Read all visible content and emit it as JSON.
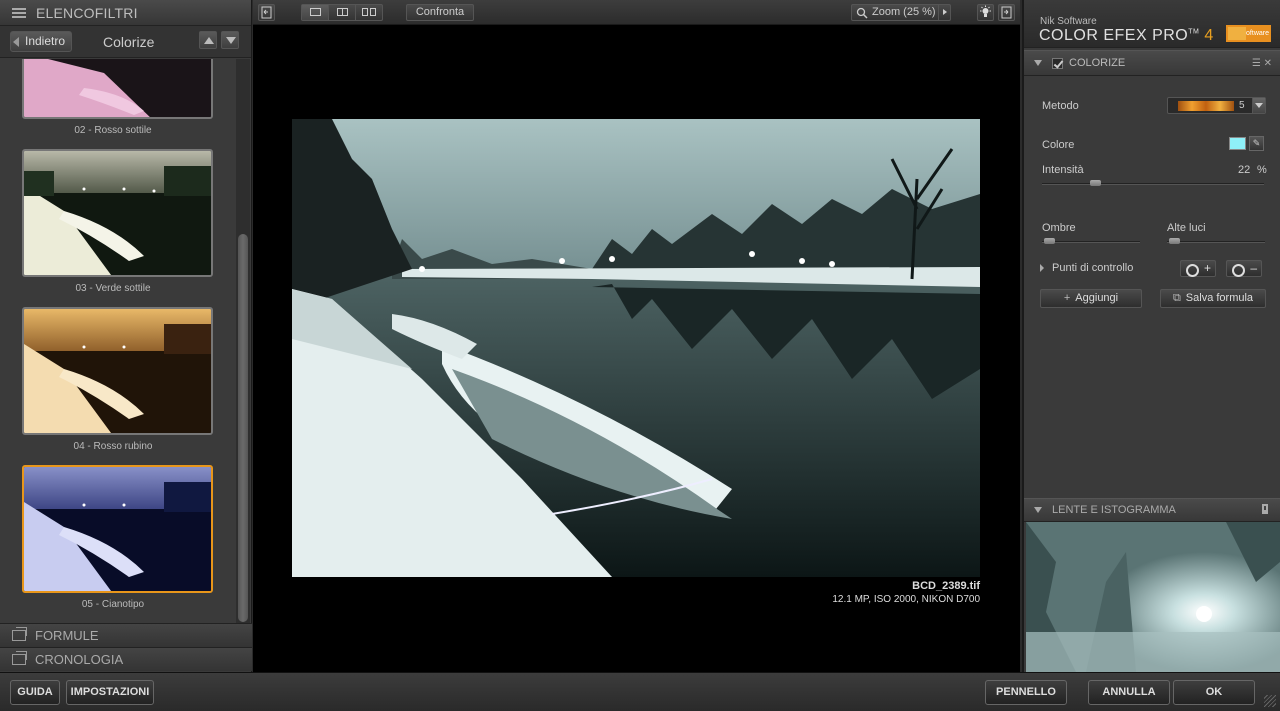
{
  "left_panel": {
    "header": "ELENCOFILTRI",
    "back_label": "Indietro",
    "nav_title": "Colorize",
    "thumbnails": [
      {
        "label": "02 - Rosso sottile",
        "selected": false
      },
      {
        "label": "03 - Verde sottile",
        "selected": false
      },
      {
        "label": "04 - Rosso rubino",
        "selected": false
      },
      {
        "label": "05 - Cianotipo",
        "selected": true
      }
    ],
    "sections": [
      "FORMULE",
      "CRONOLOGIA"
    ]
  },
  "toolbar": {
    "compare_label": "Confronta",
    "zoom_label": "Zoom (25 %)"
  },
  "image_info": {
    "filename": "BCD_2389.tif",
    "meta": "12.1 MP, ISO 2000, NIKON D700"
  },
  "right_panel": {
    "brand_small": "Nik Software",
    "brand_name": "COLOR EFEX PRO",
    "brand_tm": "TM",
    "brand_version": "4",
    "logo_text": "Software",
    "filter_title": "COLORIZE",
    "method_label": "Metodo",
    "method_value": "5",
    "color_label": "Colore",
    "color_value": "#8ff0f8",
    "intensity_label": "Intensità",
    "intensity_value": "22",
    "intensity_unit": "%",
    "shadows_label": "Ombre",
    "highlights_label": "Alte luci",
    "control_points_label": "Punti di controllo",
    "cp_add": "+",
    "cp_remove": "–",
    "add_label": "Aggiungi",
    "save_label": "Salva formula",
    "lens_title": "LENTE E ISTOGRAMMA"
  },
  "bottom_bar": {
    "help": "GUIDA",
    "settings": "IMPOSTAZIONI",
    "brush": "PENNELLO",
    "cancel": "ANNULLA",
    "ok": "OK"
  },
  "colors": {
    "accent": "#e8961a",
    "background": "#3a3a3a"
  }
}
